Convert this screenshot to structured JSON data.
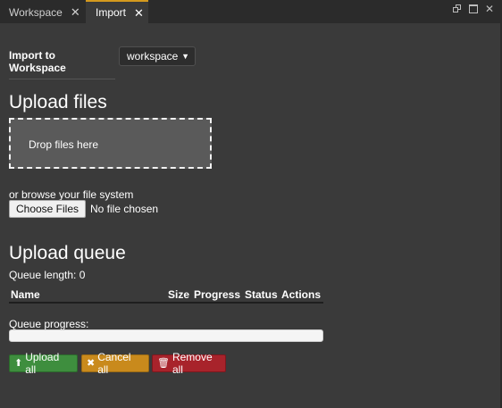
{
  "tabs": [
    {
      "label": "Workspace",
      "active": false
    },
    {
      "label": "Import",
      "active": true
    }
  ],
  "window_controls": {
    "restore": "restore-icon",
    "maximize": "maximize-icon",
    "close": "✕"
  },
  "import_to": {
    "label": "Import to Workspace",
    "selected": "workspace"
  },
  "upload": {
    "heading": "Upload files",
    "dropzone_text": "Drop files here",
    "browse_text": "or browse your file system",
    "choose_button": "Choose Files",
    "no_file_text": "No file chosen"
  },
  "queue": {
    "heading": "Upload queue",
    "length_text": "Queue length: 0",
    "columns": [
      "Name",
      "Size",
      "Progress",
      "Status",
      "Actions"
    ],
    "progress_label": "Queue progress:",
    "progress": 0
  },
  "buttons": {
    "upload_all": "Upload all",
    "cancel_all": "Cancel all",
    "remove_all": "Remove all"
  },
  "colors": {
    "background": "#3a3a3a",
    "tab_active_accent": "#d49a1e",
    "upload_green": "#3e8e3e",
    "cancel_orange": "#c98a1c",
    "remove_red": "#a8232b"
  }
}
